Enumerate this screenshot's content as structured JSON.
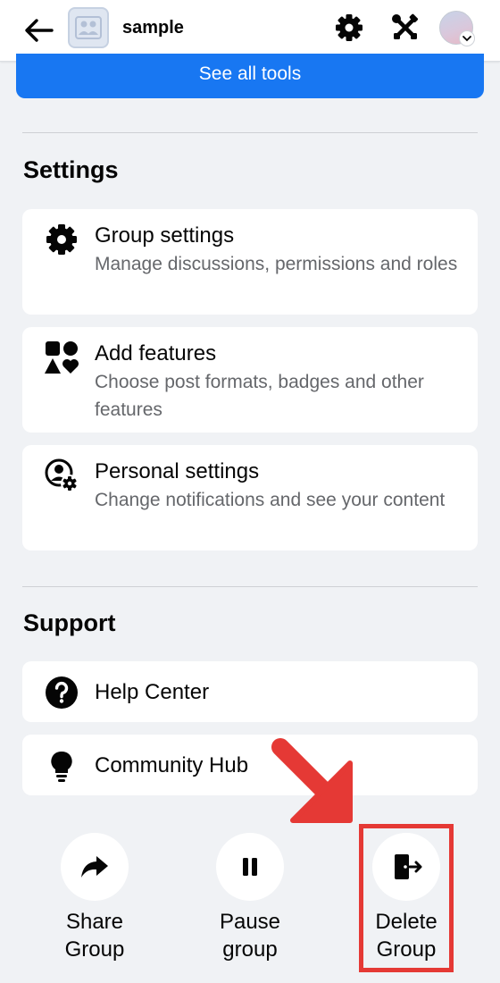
{
  "header": {
    "group_name": "sample",
    "icons": [
      "back-arrow-icon",
      "group-thumbnail",
      "settings-gear-icon",
      "tools-icon",
      "profile-avatar"
    ]
  },
  "banner": {
    "see_all_label": "See all tools",
    "color": "#1877f2"
  },
  "settings": {
    "title": "Settings",
    "items": [
      {
        "icon": "gear-icon",
        "title": "Group settings",
        "subtitle": "Manage discussions, permissions and roles"
      },
      {
        "icon": "shapes-icon",
        "title": "Add features",
        "subtitle": "Choose post formats, badges and other features"
      },
      {
        "icon": "person-gear-icon",
        "title": "Personal settings",
        "subtitle": "Change notifications and see your content"
      }
    ]
  },
  "support": {
    "title": "Support",
    "items": [
      {
        "icon": "question-icon",
        "title": "Help Center"
      },
      {
        "icon": "lightbulb-icon",
        "title": "Community Hub"
      }
    ]
  },
  "actions": [
    {
      "icon": "share-icon",
      "line1": "Share",
      "line2": "Group"
    },
    {
      "icon": "pause-icon",
      "line1": "Pause",
      "line2": "group"
    },
    {
      "icon": "exit-icon",
      "line1": "Delete",
      "line2": "Group"
    }
  ],
  "annotation": {
    "color": "#e53935",
    "target": "Delete Group"
  }
}
